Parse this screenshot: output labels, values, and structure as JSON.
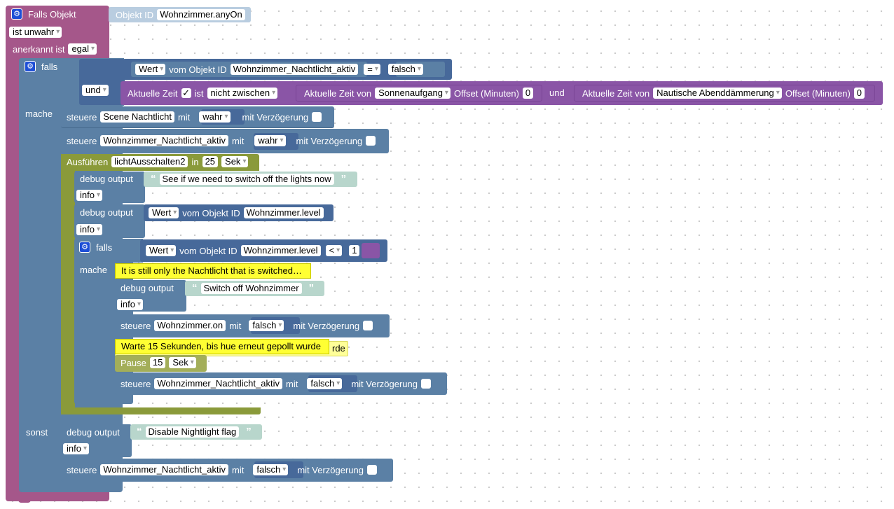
{
  "trigger": {
    "title": "Falls Objekt",
    "object_id_label": "Objekt ID",
    "object_id": "Wohnzimmer.anyOn",
    "condition": "ist unwahr",
    "ack_label": "anerkannt ist",
    "ack_value": "egal"
  },
  "if1": {
    "falls": "falls",
    "mache": "mache",
    "sonst": "sonst",
    "cond1": {
      "prop": "Wert",
      "of_obj": "vom Objekt ID",
      "obj": "Wohnzimmer_Nachtlicht_aktiv",
      "op": "=",
      "value": "falsch"
    },
    "logic_op": "und",
    "cond2": {
      "label": "Aktuelle Zeit",
      "checked": "✓",
      "ist": "ist",
      "mode": "nicht zwischen",
      "from_label": "Aktuelle Zeit von",
      "from": "Sonnenaufgang",
      "offset_label": "Offset (Minuten)",
      "from_offset": "0",
      "and": "und",
      "to_label": "Aktuelle Zeit von",
      "to": "Nautische Abenddämmerung",
      "to_offset": "0"
    }
  },
  "steuere1": {
    "label": "steuere",
    "obj": "Scene Nachtlicht",
    "mit": "mit",
    "value": "wahr",
    "delay": "mit Verzögerung"
  },
  "steuere2": {
    "label": "steuere",
    "obj": "Wohnzimmer_Nachtlicht_aktiv",
    "mit": "mit",
    "value": "wahr",
    "delay": "mit Verzögerung"
  },
  "timeout": {
    "label": "Ausführen",
    "name": "lichtAusschalten2",
    "in": "in",
    "value": "25",
    "unit": "Sek"
  },
  "debug1": {
    "label": "debug output",
    "text": "See if we need to switch off the lights now",
    "level": "info"
  },
  "debug2": {
    "label": "debug output",
    "prop": "Wert",
    "of_obj": "vom Objekt ID",
    "obj": "Wohnzimmer.level",
    "level": "info"
  },
  "if2": {
    "falls": "falls",
    "mache": "mache",
    "cond": {
      "prop": "Wert",
      "of_obj": "vom Objekt ID",
      "obj": "Wohnzimmer.level",
      "op": "<",
      "value": "1"
    },
    "comment1": "It is still only the Nachtlicht that is switched…",
    "debug": {
      "label": "debug output",
      "text": "Switch off Wohnzimmer",
      "level": "info"
    },
    "steuere_a": {
      "label": "steuere",
      "obj": "Wohnzimmer.on",
      "mit": "mit",
      "value": "falsch",
      "delay": "mit Verzögerung"
    },
    "comment2": "Warte 15 Sekunden, bis hue erneut gepollt wurde",
    "comment2_behind": "rde",
    "pause": {
      "label": "Pause",
      "value": "15",
      "unit": "Sek"
    },
    "steuere_b": {
      "label": "steuere",
      "obj": "Wohnzimmer_Nachtlicht_aktiv",
      "mit": "mit",
      "value": "falsch",
      "delay": "mit Verzögerung"
    }
  },
  "else": {
    "debug": {
      "label": "debug output",
      "text": "Disable Nightlight flag",
      "level": "info"
    },
    "steuere": {
      "label": "steuere",
      "obj": "Wohnzimmer_Nachtlicht_aktiv",
      "mit": "mit",
      "value": "falsch",
      "delay": "mit Verzögerung"
    }
  },
  "gear_glyph": "⚙",
  "colors": {
    "trigger": "#a5578a",
    "logic": "#5b80a5",
    "timeout": "#8a9a3a",
    "time": "#8a55a6",
    "comment": "#ffff33"
  }
}
